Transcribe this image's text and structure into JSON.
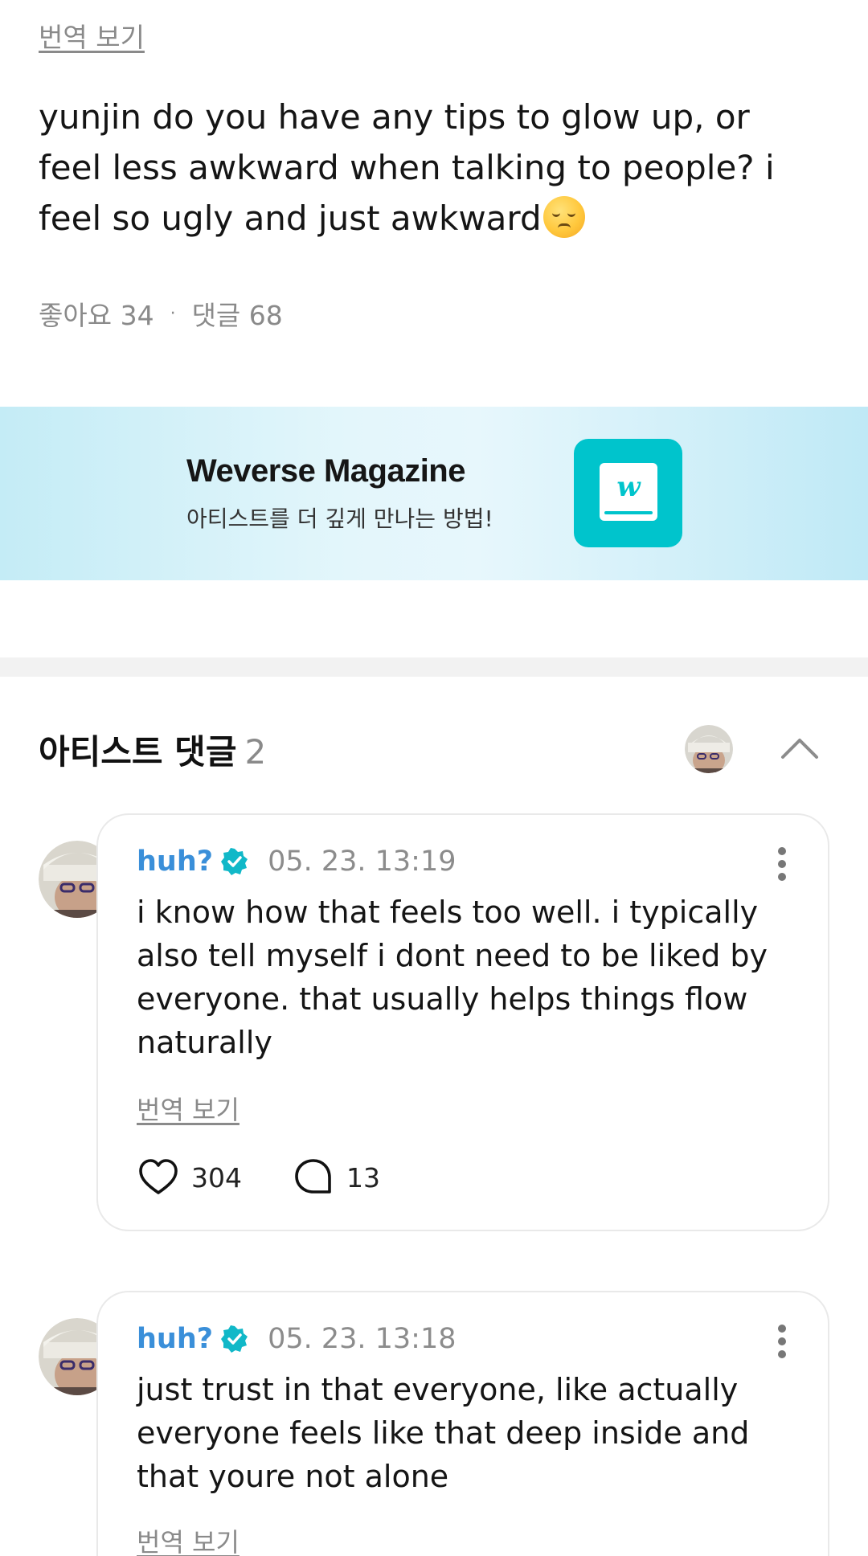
{
  "post": {
    "translate_label": "번역 보기",
    "body": "yunjin do you have any tips to glow up, or feel less awkward when talking to people? i feel so ugly and just awkward",
    "emoji_icon": "pensive-face-emoji",
    "likes_label": "좋아요 34",
    "stats_separator": "·",
    "comments_label": "댓글 68"
  },
  "banner": {
    "title": "Weverse Magazine",
    "subtitle": "아티스트를 더 깊게 만나는 방법!",
    "logo_icon": "weverse-magazine-book-icon",
    "logo_glyph": "w",
    "accent_color": "#00c4cc"
  },
  "artist_comments": {
    "title": "아티스트 댓글",
    "count": "2",
    "collapse_icon": "chevron-up-icon",
    "items": [
      {
        "author": "huh?",
        "verified_icon": "verified-badge-icon",
        "date": "05. 23. 13:19",
        "text": "i know how that feels too well. i typically also tell myself i dont need to be liked by everyone. that usually helps things flow naturally",
        "translate_label": "번역 보기",
        "likes": "304",
        "replies": "13"
      },
      {
        "author": "huh?",
        "verified_icon": "verified-badge-icon",
        "date": "05. 23. 13:18",
        "text": "just trust in that everyone, like actually everyone feels like that deep inside and that youre not alone",
        "translate_label": "번역 보기"
      }
    ]
  },
  "colors": {
    "author_blue": "#3a8fd9",
    "verified_teal": "#11b8c8",
    "muted_gray": "#8a8a8a"
  }
}
